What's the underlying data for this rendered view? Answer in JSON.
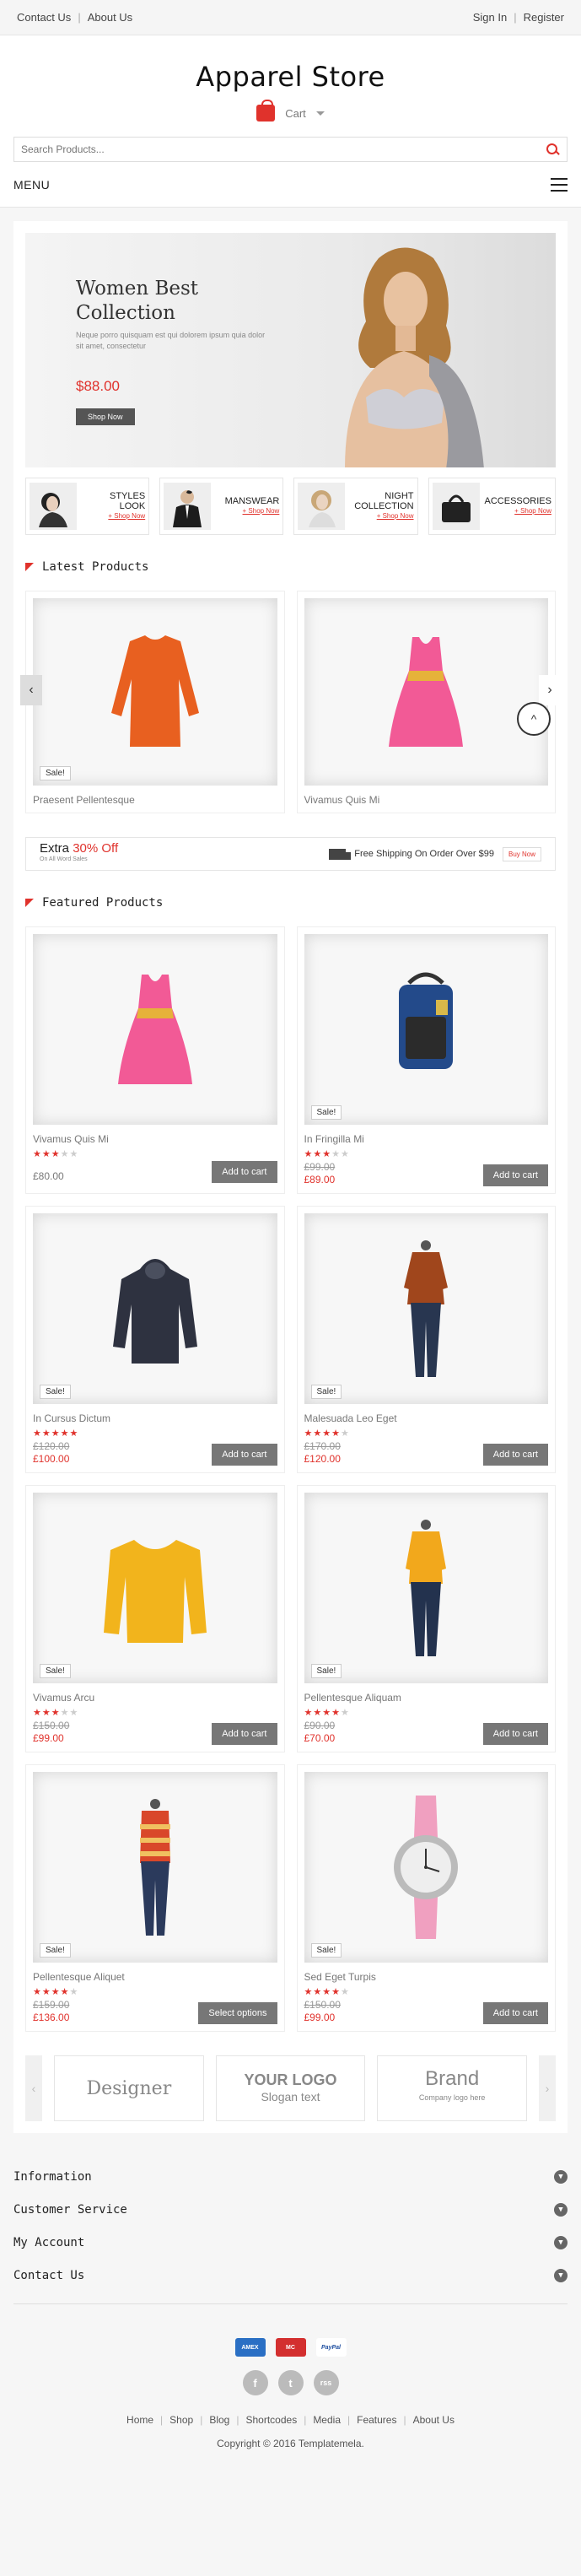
{
  "topbar": {
    "contact": "Contact Us",
    "about": "About Us",
    "signin": "Sign In",
    "register": "Register"
  },
  "header": {
    "logo": "Apparel Store",
    "cart_label": "Cart",
    "search_placeholder": "Search Products...",
    "menu_label": "MENU"
  },
  "banner": {
    "title": "Women Best Collection",
    "text": "Neque porro quisquam est qui dolorem ipsum quia dolor sit amet, consectetur",
    "price": "$88.00",
    "button": "Shop Now"
  },
  "categories": [
    {
      "name": "STYLES LOOK",
      "link": "+ Shop Now"
    },
    {
      "name": "MANSWEAR",
      "link": "+ Shop Now"
    },
    {
      "name": "NIGHT COLLECTION",
      "link": "+ Shop Now"
    },
    {
      "name": "ACCESSORIES",
      "link": "+ Shop Now"
    }
  ],
  "latest": {
    "title": "Latest Products",
    "items": [
      {
        "name": "Praesent Pellentesque",
        "sale": "Sale!"
      },
      {
        "name": "Vivamus Quis Mi",
        "sale": ""
      }
    ]
  },
  "promo": {
    "extra": "Extra",
    "percent": "30% Off",
    "sub": "On All Word Sales",
    "shipping": "Free Shipping On Order Over $99",
    "buy": "Buy Now"
  },
  "featured": {
    "title": "Featured Products",
    "items": [
      {
        "name": "Vivamus Quis Mi",
        "sale": "",
        "rating": 3,
        "old_price": "",
        "price": "£80.00",
        "button": "Add to cart"
      },
      {
        "name": "In Fringilla Mi",
        "sale": "Sale!",
        "rating": 3,
        "old_price": "£99.00",
        "price": "£89.00",
        "button": "Add to cart"
      },
      {
        "name": "In Cursus Dictum",
        "sale": "Sale!",
        "rating": 5,
        "old_price": "£120.00",
        "price": "£100.00",
        "button": "Add to cart"
      },
      {
        "name": "Malesuada Leo Eget",
        "sale": "Sale!",
        "rating": 4,
        "old_price": "£170.00",
        "price": "£120.00",
        "button": "Add to cart"
      },
      {
        "name": "Vivamus Arcu",
        "sale": "Sale!",
        "rating": 3,
        "old_price": "£150.00",
        "price": "£99.00",
        "button": "Add to cart"
      },
      {
        "name": "Pellentesque Aliquam",
        "sale": "Sale!",
        "rating": 4,
        "old_price": "£90.00",
        "price": "£70.00",
        "button": "Add to cart"
      },
      {
        "name": "Pellentesque Aliquet",
        "sale": "Sale!",
        "rating": 4,
        "old_price": "£159.00",
        "price": "£136.00",
        "button": "Select options"
      },
      {
        "name": "Sed Eget Turpis",
        "sale": "Sale!",
        "rating": 4,
        "old_price": "£150.00",
        "price": "£99.00",
        "button": "Add to cart"
      }
    ]
  },
  "brands": [
    {
      "line1": "Designer",
      "line2": ""
    },
    {
      "line1": "YOUR LOGO",
      "line2": "Slogan text"
    },
    {
      "line1": "Brand",
      "line2": "Company logo here"
    }
  ],
  "footer": {
    "sections": [
      "Information",
      "Customer Service",
      "My Account",
      "Contact Us"
    ],
    "payments": [
      "AMEX",
      "MC",
      "PayPal"
    ],
    "social": [
      "f",
      "t",
      "rss"
    ],
    "links": [
      "Home",
      "Shop",
      "Blog",
      "Shortcodes",
      "Media",
      "Features",
      "About Us"
    ],
    "copyright": "Copyright © 2016 Templatemela."
  },
  "colors": {
    "accent": "#e0322c",
    "button": "#777777"
  }
}
